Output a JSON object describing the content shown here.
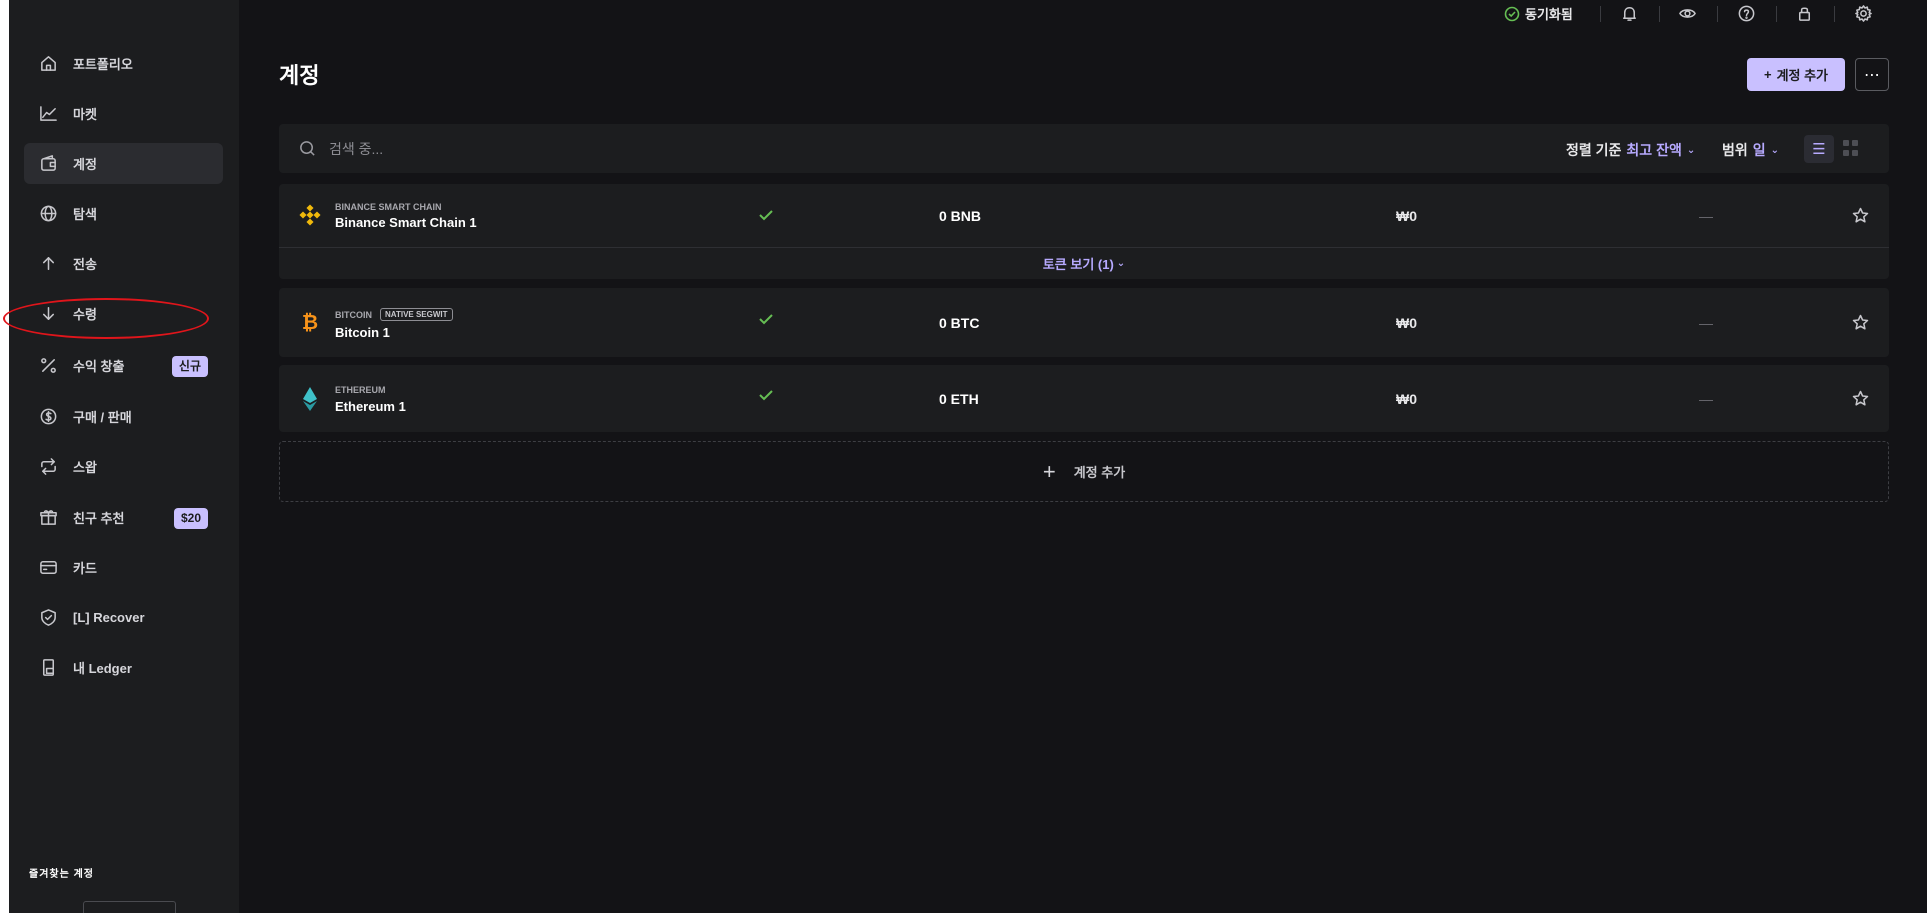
{
  "sidebar": {
    "items": [
      {
        "label": "포트폴리오",
        "icon": "home-icon"
      },
      {
        "label": "마켓",
        "icon": "chart-line-icon"
      },
      {
        "label": "계정",
        "icon": "wallet-icon"
      },
      {
        "label": "탐색",
        "icon": "globe-icon"
      },
      {
        "label": "전송",
        "icon": "arrow-up-icon"
      },
      {
        "label": "수령",
        "icon": "arrow-down-icon"
      },
      {
        "label": "수익 창출",
        "icon": "percent-icon",
        "badge": "신규"
      },
      {
        "label": "구매 / 판매",
        "icon": "coin-icon"
      },
      {
        "label": "스왑",
        "icon": "swap-icon"
      },
      {
        "label": "친구 추천",
        "icon": "gift-icon",
        "badge": "$20"
      },
      {
        "label": "카드",
        "icon": "card-icon"
      },
      {
        "label": "[L] Recover",
        "icon": "shield-icon"
      },
      {
        "label": "내 Ledger",
        "icon": "device-icon"
      }
    ],
    "active_index": 2,
    "favorites_title": "즐겨찾는 계정"
  },
  "topbar": {
    "sync_label": "동기화됨",
    "icons": [
      "bell-icon",
      "eye-icon",
      "help-icon",
      "lock-icon",
      "settings-icon"
    ]
  },
  "main": {
    "title": "계정",
    "add_account_label": "계정 추가",
    "more_label": "⋯",
    "search_placeholder": "검색 중...",
    "sort_label": "정렬 기준",
    "sort_value": "최고 잔액",
    "range_label": "범위",
    "range_value": "일",
    "accounts": [
      {
        "network": "BINANCE SMART CHAIN",
        "tag": "",
        "name": "Binance Smart Chain 1",
        "balance": "0 BNB",
        "fiat": "₩0",
        "change": "—",
        "token_toggle": "토큰 보기 (1)"
      },
      {
        "network": "BITCOIN",
        "tag": "NATIVE SEGWIT",
        "name": "Bitcoin 1",
        "balance": "0 BTC",
        "fiat": "₩0",
        "change": "—"
      },
      {
        "network": "ETHEREUM",
        "tag": "",
        "name": "Ethereum 1",
        "balance": "0 ETH",
        "fiat": "₩0",
        "change": "—"
      }
    ],
    "add_row_label": "계정 추가"
  },
  "colors": {
    "accent": "#c9c0ff",
    "accent_text": "#b7aaff",
    "success": "#66be54",
    "bnb": "#f0b90b",
    "btc": "#f7931a",
    "eth": "#3fc1c9",
    "annotation": "#e0151b"
  }
}
